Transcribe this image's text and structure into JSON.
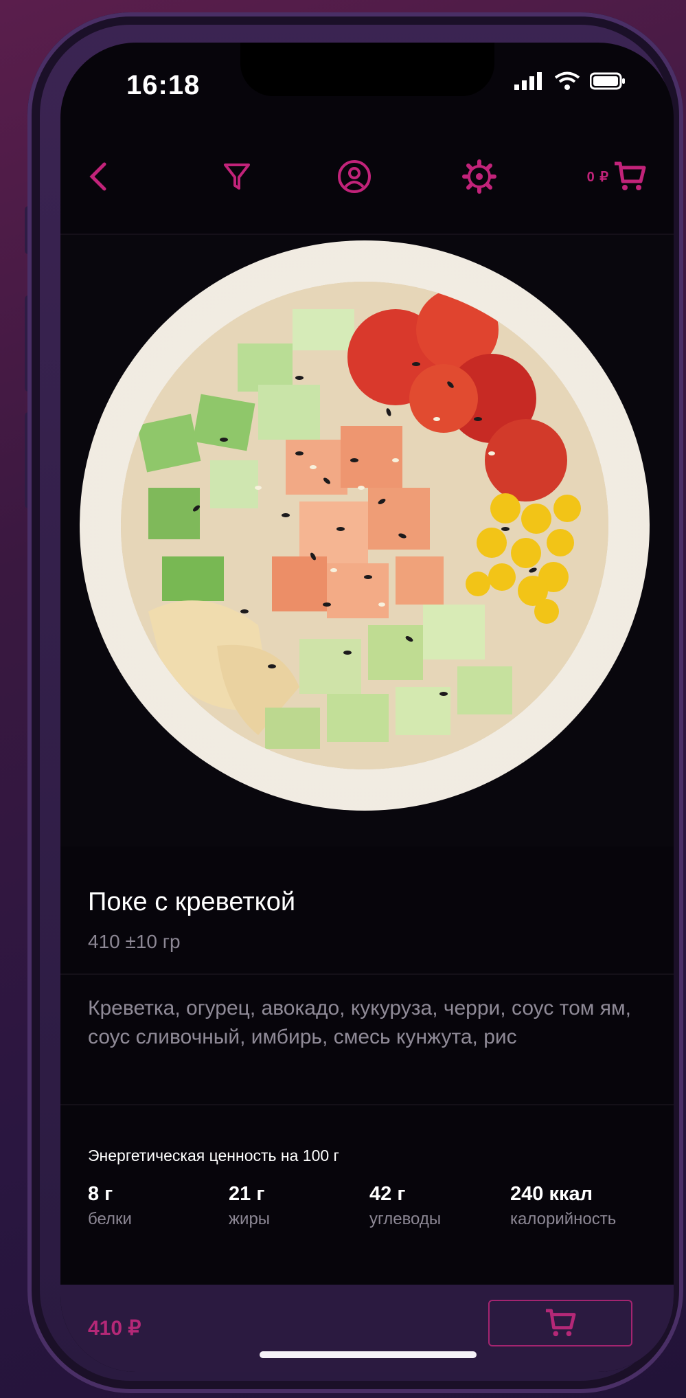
{
  "status": {
    "time": "16:18"
  },
  "header": {
    "cart_amount": "0 ₽"
  },
  "product": {
    "title": "Поке с креветкой",
    "weight": "410 ±10 гр",
    "description": "Креветка, огурец, авокадо, кукуруза, черри, соус том ям, соус сливочный, имбирь, смесь кунжута, рис"
  },
  "nutrition": {
    "heading": "Энергетическая ценность на 100 г",
    "items": [
      {
        "value": "8 г",
        "label": "белки"
      },
      {
        "value": "21 г",
        "label": "жиры"
      },
      {
        "value": "42 г",
        "label": "углеводы"
      },
      {
        "value": "240 ккал",
        "label": "калорийность"
      }
    ]
  },
  "footer": {
    "price": "410 ₽"
  },
  "colors": {
    "accent": "#c2237a",
    "background": "#07050b",
    "bar": "#2b1a40"
  },
  "icons": [
    "back-icon",
    "filter-icon",
    "profile-icon",
    "settings-icon",
    "cart-icon"
  ]
}
